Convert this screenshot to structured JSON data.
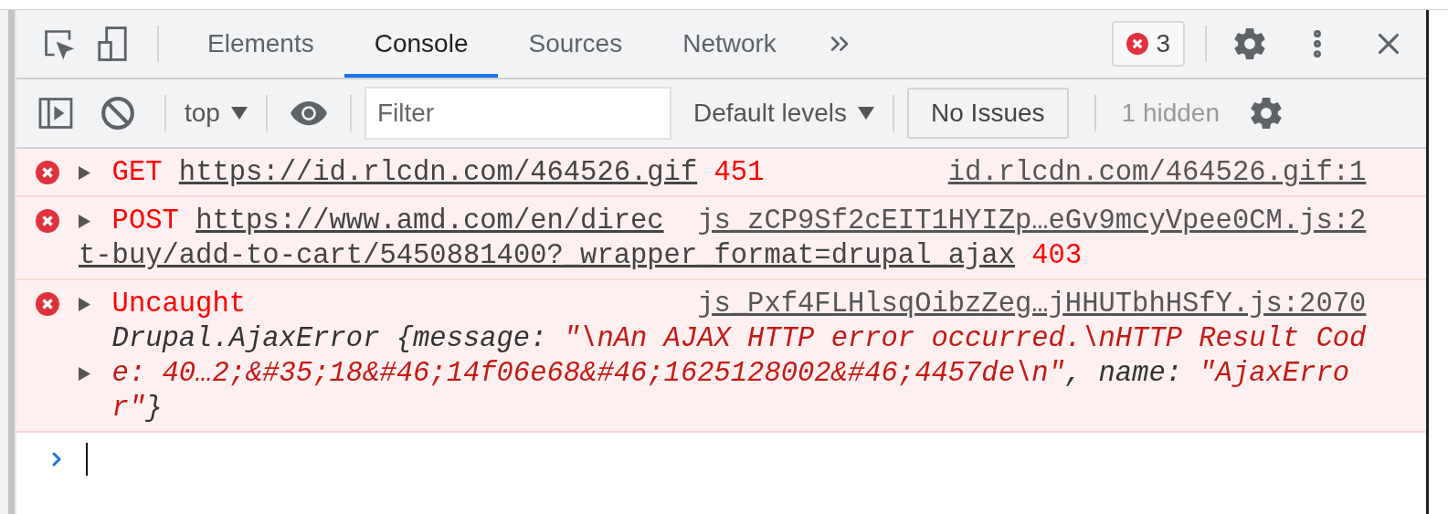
{
  "tabs": [
    {
      "label": "Elements",
      "selected": false
    },
    {
      "label": "Console",
      "selected": true
    },
    {
      "label": "Sources",
      "selected": false
    },
    {
      "label": "Network",
      "selected": false
    }
  ],
  "error_count": "3",
  "toolbar": {
    "context": "top",
    "filter": {
      "placeholder": "Filter"
    },
    "levels": "Default levels",
    "issues_button": "No Issues",
    "hidden_count": "1 hidden"
  },
  "messages": [
    {
      "kind": "network",
      "expanded": false,
      "method": "GET",
      "url_lines": [
        "https://id.rlcdn.com/464526.gif"
      ],
      "status": "451",
      "source": "id.rlcdn.com/464526.gif:1"
    },
    {
      "kind": "network",
      "expanded": false,
      "method": "POST",
      "url_lines": [
        "https://www.amd.com/en/direc",
        "t-buy/add-to-cart/5450881400?_wrapper_format=drupal_ajax"
      ],
      "status": "403",
      "source": "js_zCP9Sf2cEIT1HYIZp…eGv9mcyVpee0CM.js:2"
    },
    {
      "kind": "exception",
      "expanded": false,
      "label": "Uncaught",
      "source": "js_Pxf4FLHlsqOibzZeg…jHHUTbhHSfY.js:2070",
      "object": {
        "expanded": false,
        "segments": [
          {
            "kind": "plain",
            "text": "Drupal.AjaxError {message: "
          },
          {
            "kind": "string",
            "text": "\"\\nAn AJAX HTTP error occurred.\\nHTTP Result Code: 40…2;&#35;18&#46;14f06e68&#46;1625128002&#46;4457de\\n\""
          },
          {
            "kind": "plain",
            "text": ", name: "
          },
          {
            "kind": "string",
            "text": "\"AjaxError\""
          },
          {
            "kind": "plain",
            "text": "}"
          }
        ]
      }
    }
  ]
}
